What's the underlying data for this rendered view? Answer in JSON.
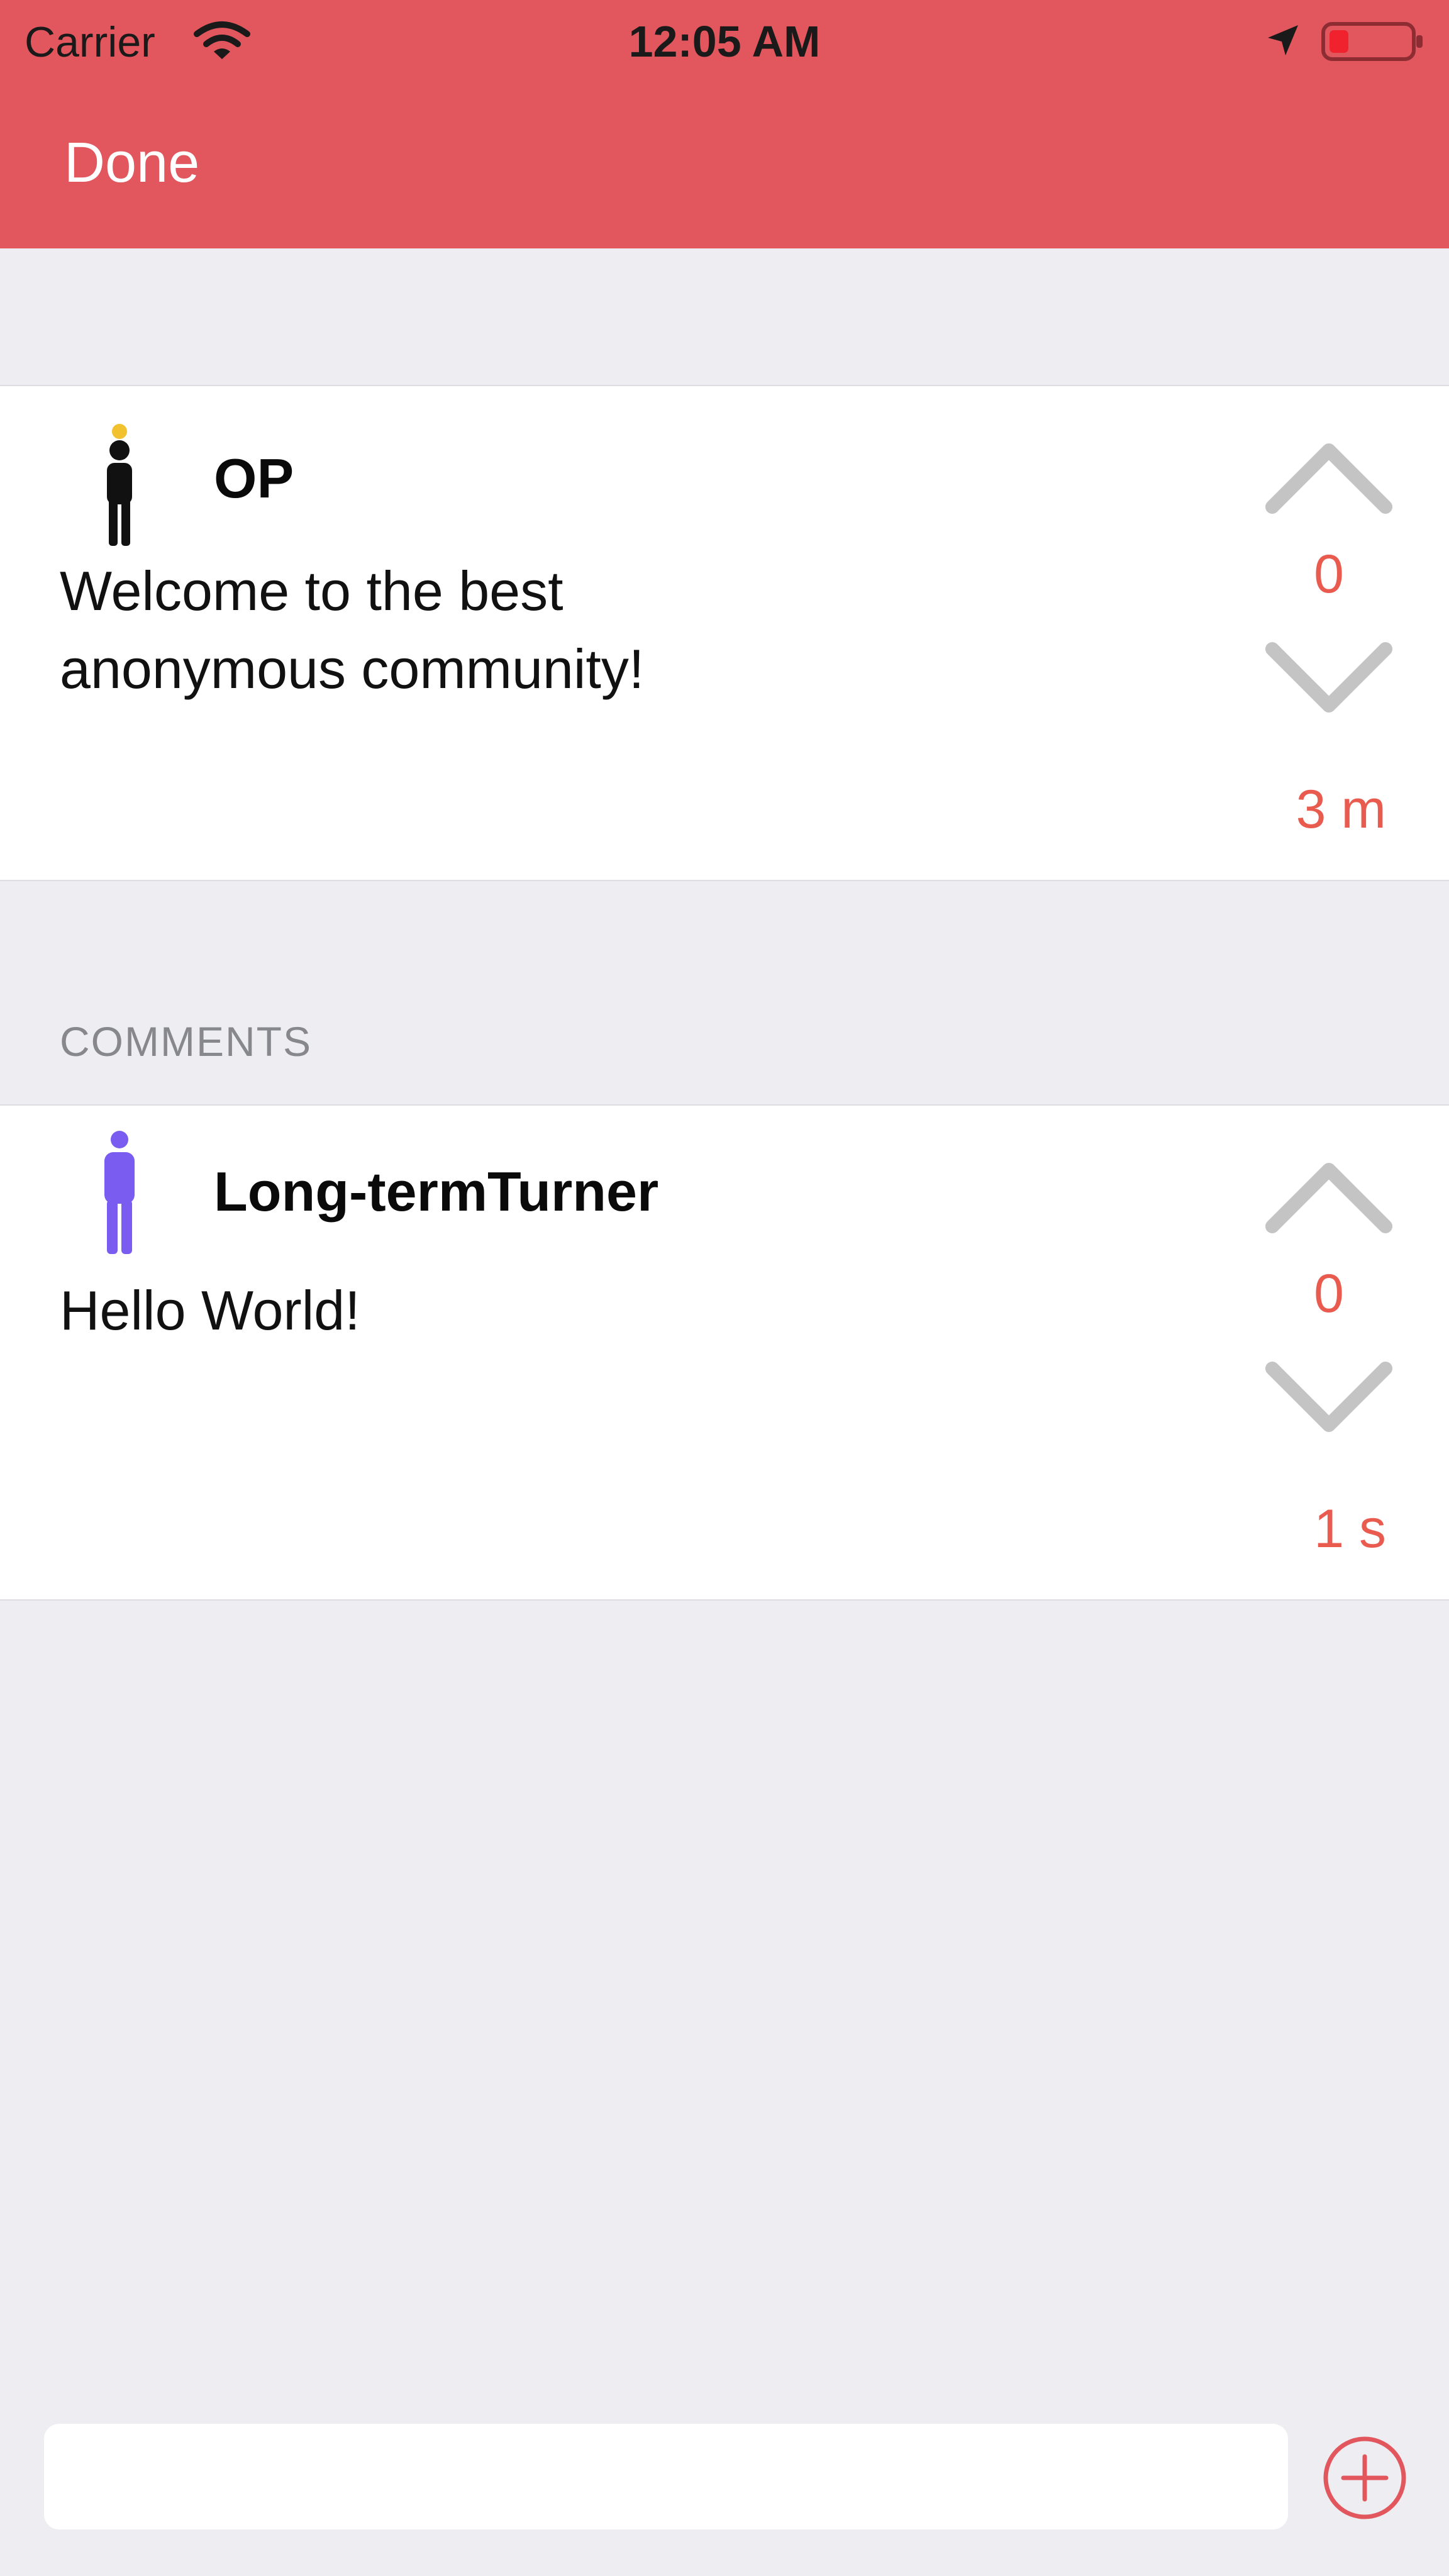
{
  "status": {
    "carrier": "Carrier",
    "time": "12:05 AM"
  },
  "nav": {
    "done_label": "Done"
  },
  "post": {
    "author": "OP",
    "text_line1": "Welcome to the best",
    "text_line2": "anonymous community!",
    "score": "0",
    "age": "3 m",
    "avatar_icon": "person-icon",
    "avatar_color": "#111111",
    "avatar_accent": "#F2C12E"
  },
  "comments_header": "COMMENTS",
  "comments": [
    {
      "author": "Long-termTurner",
      "text": "Hello World!",
      "score": "0",
      "age": "1 s",
      "avatar_icon": "person-icon",
      "avatar_color": "#7A5CF0"
    }
  ],
  "composer": {
    "add_icon": "plus-circle-icon"
  },
  "colors": {
    "accent": "#E2565E",
    "score": "#EA5B4F",
    "chevron": "#C4C4C4",
    "background": "#EDEDF2"
  }
}
